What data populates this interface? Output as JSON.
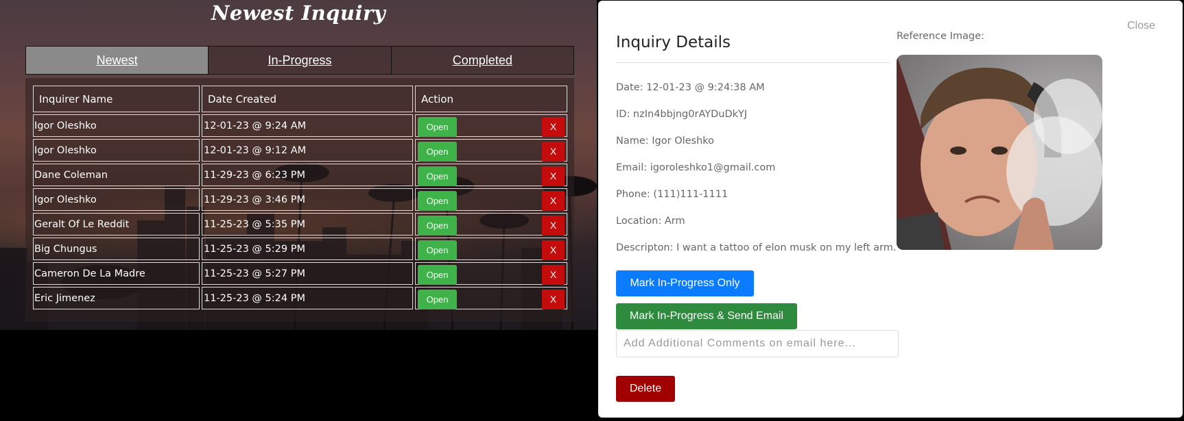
{
  "page": {
    "title": "Newest Inquiry"
  },
  "tabs": [
    {
      "label": "Newest",
      "active": true
    },
    {
      "label": "In-Progress",
      "active": false
    },
    {
      "label": "Completed",
      "active": false
    }
  ],
  "table": {
    "headers": [
      "Inquirer Name",
      "Date Created",
      "Action"
    ],
    "open_label": "Open",
    "delete_label": "X",
    "rows": [
      {
        "name": "Igor Oleshko",
        "date": "12-01-23 @ 9:24 AM"
      },
      {
        "name": "Igor Oleshko",
        "date": "12-01-23 @ 9:12 AM"
      },
      {
        "name": "Dane Coleman",
        "date": "11-29-23 @ 6:23 PM"
      },
      {
        "name": "Igor Oleshko",
        "date": "11-29-23 @ 3:46 PM"
      },
      {
        "name": "Geralt Of Le Reddit",
        "date": "11-25-23 @ 5:35 PM"
      },
      {
        "name": "Big Chungus",
        "date": "11-25-23 @ 5:29 PM"
      },
      {
        "name": "Cameron De La Madre",
        "date": "11-25-23 @ 5:27 PM"
      },
      {
        "name": "Eric Jimenez",
        "date": "11-25-23 @ 5:24 PM"
      }
    ]
  },
  "modal": {
    "close_label": "Close",
    "title": "Inquiry Details",
    "details": [
      "Date: 12-01-23 @ 9:24:38 AM",
      "ID: nzIn4bbjng0rAYDuDkYJ",
      "Name: Igor Oleshko",
      "Email: igoroleshko1@gmail.com",
      "Phone: (111)111-1111",
      "Location: Arm",
      "Descripton: I want a tattoo of elon musk on my left arm."
    ],
    "reference_label": "Reference Image:",
    "mark_in_progress_label": "Mark In-Progress Only",
    "mark_send_email_label": "Mark In-Progress & Send Email",
    "comment_placeholder": "Add Additional Comments on email here...",
    "comment_value": "",
    "delete_label": "Delete"
  },
  "colors": {
    "open_button": "#3fb24a",
    "delete_x_button": "#c40c0c",
    "blue_button": "#0b7cff",
    "green_button": "#2e8b3e",
    "delete_button": "#a10000",
    "active_tab": "#8a8a8a"
  }
}
